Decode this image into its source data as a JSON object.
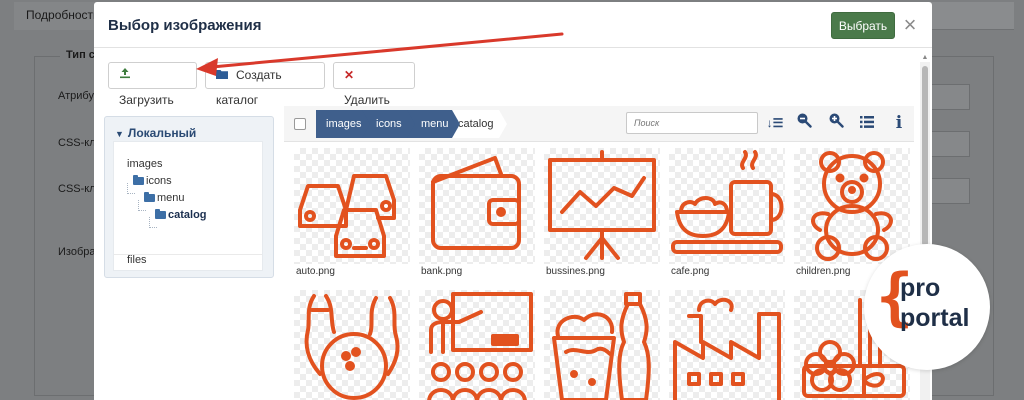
{
  "background": {
    "tab_label": "Подробности",
    "legend": "Тип со",
    "labels": [
      "Атрибут",
      "CSS-кла",
      "CSS-кла",
      "Изобра"
    ]
  },
  "dialog": {
    "title": "Выбор изображения",
    "select_label": "Выбрать",
    "close_symbol": "×"
  },
  "toolbar": {
    "upload_label": "Загрузить",
    "create_folder_label": "Создать каталог",
    "delete_label": "Удалить"
  },
  "tree": {
    "header": "Локальный",
    "items": [
      {
        "label": "images"
      },
      {
        "label": "icons"
      },
      {
        "label": "menu"
      },
      {
        "label": "catalog"
      },
      {
        "label": "files"
      }
    ]
  },
  "breadcrumb": [
    "images",
    "icons",
    "menu",
    "catalog"
  ],
  "search": {
    "placeholder": "Поиск"
  },
  "view_icons": [
    "sort-icon",
    "zoom-out-icon",
    "zoom-in-icon",
    "list-view-icon",
    "info-icon"
  ],
  "files": [
    {
      "name": "auto.png",
      "icon": "cars-icon"
    },
    {
      "name": "bank.png",
      "icon": "wallet-icon"
    },
    {
      "name": "bussines.png",
      "icon": "presentation-chart-icon"
    },
    {
      "name": "cafe.png",
      "icon": "coffee-cup-icon"
    },
    {
      "name": "children.png",
      "icon": "teddy-bear-icon"
    },
    {
      "name": "",
      "icon": "bowling-icon"
    },
    {
      "name": "",
      "icon": "classroom-icon"
    },
    {
      "name": "",
      "icon": "fast-food-icon"
    },
    {
      "name": "",
      "icon": "factory-icon"
    },
    {
      "name": "",
      "icon": "flower-gift-icon"
    }
  ],
  "badge": {
    "line1": "pro",
    "line2": "portal",
    "brace": "{"
  },
  "colors": {
    "accent": "#e2521f",
    "primary_button": "#4a7a4a",
    "breadcrumb": "#3f5f8c",
    "title": "#1f2f47"
  }
}
